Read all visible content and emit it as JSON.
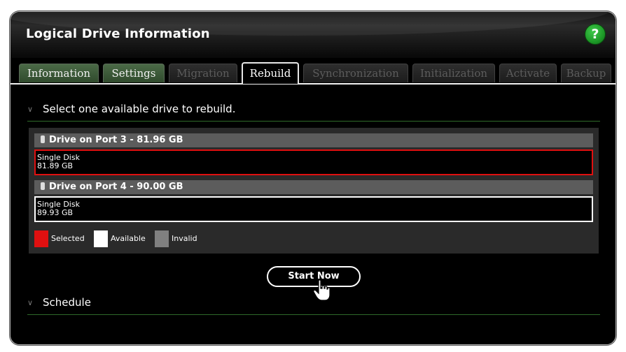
{
  "window": {
    "title": "Logical Drive Information",
    "help_label": "?"
  },
  "tabs": [
    {
      "label": "Information",
      "state": "enabled"
    },
    {
      "label": "Settings",
      "state": "enabled"
    },
    {
      "label": "Migration",
      "state": "disabled"
    },
    {
      "label": "Rebuild",
      "state": "active"
    },
    {
      "label": "Synchronization",
      "state": "disabled"
    },
    {
      "label": "Initialization",
      "state": "disabled"
    },
    {
      "label": "Activate",
      "state": "disabled"
    },
    {
      "label": "Backup",
      "state": "disabled"
    }
  ],
  "rebuild": {
    "instruction": "Select one available drive to rebuild.",
    "drives": [
      {
        "header": "Drive on Port 3 - 81.96 GB",
        "type": "Single Disk",
        "size": "81.89 GB",
        "state": "selected"
      },
      {
        "header": "Drive on Port 4 - 90.00 GB",
        "type": "Single Disk",
        "size": "89.93 GB",
        "state": "available"
      }
    ],
    "legend": [
      {
        "label": "Selected",
        "color": "#e01010"
      },
      {
        "label": "Available",
        "color": "#ffffff"
      },
      {
        "label": "Invalid",
        "color": "#808080"
      }
    ],
    "start_button": "Start Now"
  },
  "schedule": {
    "label": "Schedule"
  },
  "colors": {
    "accent_green": "#2f6b2a",
    "tab_green": "#3b5a37",
    "selected_border": "#e01010"
  }
}
